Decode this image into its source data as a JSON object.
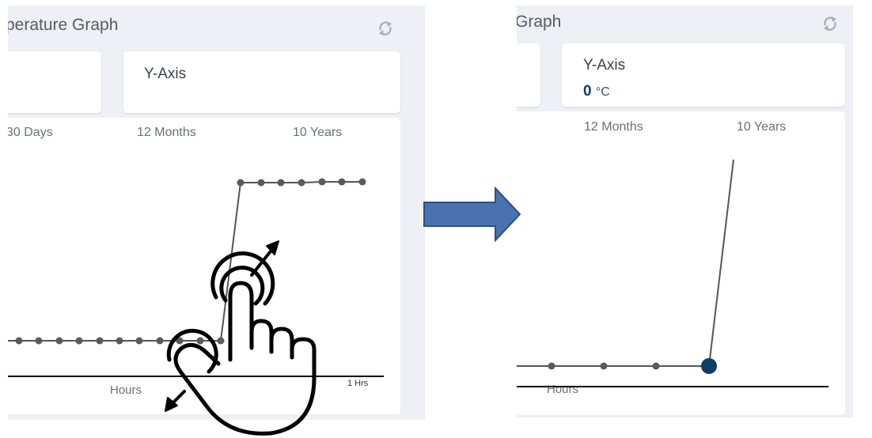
{
  "left": {
    "title": "perature Graph",
    "y_axis_card": {
      "label": "Y-Axis"
    },
    "range_tabs": [
      "30 Days",
      "12 Months",
      "10 Years"
    ],
    "x_axis_label": "Hours",
    "x_tick_label": "1 Hrs"
  },
  "right": {
    "title": "Graph",
    "y_axis_card": {
      "label": "Y-Axis",
      "value": "0",
      "unit": "°C"
    },
    "range_tabs": [
      "12 Months",
      "10 Years"
    ],
    "x_axis_label": "Hours"
  },
  "icons": {
    "refresh": "refresh-icon",
    "arrow": "right-arrow",
    "gesture": "pinch-zoom-hand-icon"
  },
  "colors": {
    "panel_bg": "#eef0f5",
    "point": "#5a5a5a",
    "selected_point": "#0d3f66",
    "arrow": "#4a72b0"
  }
}
